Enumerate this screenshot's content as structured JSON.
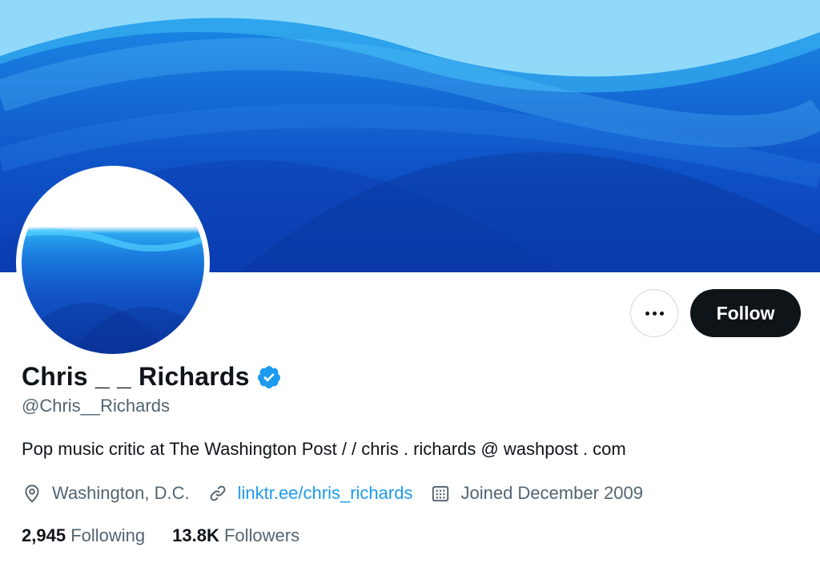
{
  "profile": {
    "display_name": "Chris _ _ Richards",
    "handle": "@Chris__Richards",
    "bio": "Pop music critic at The Washington Post / / chris . richards @ washpost . com",
    "location": "Washington, D.C.",
    "website": "linktr.ee/chris_richards",
    "joined": "Joined December 2009",
    "verified": true
  },
  "actions": {
    "follow_label": "Follow",
    "more_icon": "more-options-icon"
  },
  "stats": {
    "following_count": "2,945",
    "following_label": "Following",
    "followers_count": "13.8K",
    "followers_label": "Followers"
  },
  "colors": {
    "accent": "#1d9bf0",
    "follow_button": "#0f1419",
    "banner_blue": "#1670d8",
    "secondary_text": "#536471"
  },
  "icons": [
    "location-icon",
    "link-icon",
    "calendar-icon",
    "verified-badge-icon"
  ]
}
